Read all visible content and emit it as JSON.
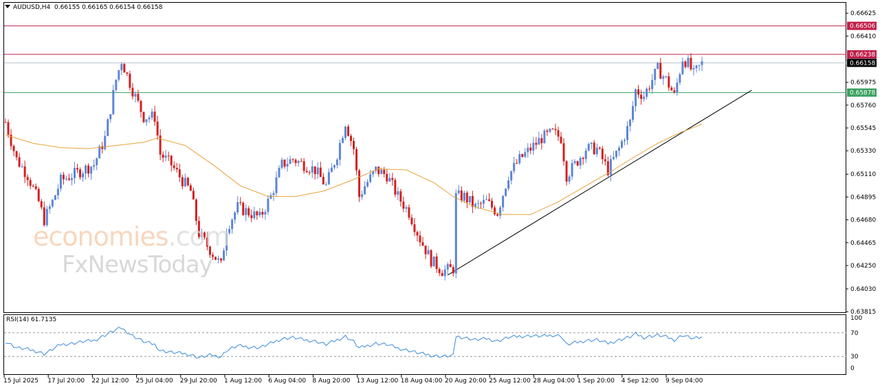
{
  "header": {
    "symbol": "AUDUSD,H4",
    "ohlc": "0.66155 0.66165 0.66154 0.66158"
  },
  "rsi_header": "RSI(14) 61.7135",
  "watermark": {
    "brand_main": "economies",
    "brand_suffix": ".com",
    "brand_second": "FxNewsToday"
  },
  "colors": {
    "bull": "#5b86d6",
    "bear": "#d32020",
    "ma": "#e8a23c",
    "rsi": "#3b8bd8",
    "resistance1": "#c0204a",
    "resistance2": "#c0204a",
    "support": "#3aa060",
    "current": "#000000"
  },
  "chart_data": {
    "type": "candlestick",
    "symbol": "AUDUSD",
    "timeframe": "H4",
    "ylim": [
      0.6381,
      0.6673
    ],
    "y_ticks": [
      "0.66625",
      "0.66410",
      "0.65975",
      "0.65760",
      "0.65545",
      "0.65330",
      "0.65110",
      "0.64895",
      "0.64680",
      "0.64465",
      "0.64250",
      "0.64030",
      "0.63815"
    ],
    "x_ticks": [
      "15 Jul 2025",
      "17 Jul 20:00",
      "22 Jul 12:00",
      "25 Jul 04:00",
      "29 Jul 20:00",
      "1 Aug 12:00",
      "6 Aug 04:00",
      "8 Aug 20:00",
      "13 Aug 12:00",
      "18 Aug 04:00",
      "20 Aug 20:00",
      "25 Aug 12:00",
      "28 Aug 04:00",
      "1 Sep 20:00",
      "4 Sep 12:00",
      "9 Sep 04:00"
    ],
    "horizontal_lines": [
      {
        "label": "0.66506",
        "value": 0.66506,
        "role": "resistance"
      },
      {
        "label": "0.66238",
        "value": 0.66238,
        "role": "resistance"
      },
      {
        "label": "0.66158",
        "value": 0.66158,
        "role": "current price"
      },
      {
        "label": "0.65878",
        "value": 0.65878,
        "role": "support"
      }
    ],
    "trendline": {
      "from": {
        "bar": 160,
        "price": 0.6416
      },
      "to": {
        "bar": 270,
        "price": 0.659
      }
    },
    "close_path": [
      [
        0,
        0.656
      ],
      [
        4,
        0.6525
      ],
      [
        8,
        0.651
      ],
      [
        12,
        0.6485
      ],
      [
        14,
        0.6468
      ],
      [
        17,
        0.6485
      ],
      [
        20,
        0.6505
      ],
      [
        24,
        0.651
      ],
      [
        28,
        0.6515
      ],
      [
        32,
        0.652
      ],
      [
        36,
        0.6545
      ],
      [
        40,
        0.66
      ],
      [
        42,
        0.6618
      ],
      [
        46,
        0.659
      ],
      [
        50,
        0.6565
      ],
      [
        54,
        0.6565
      ],
      [
        56,
        0.653
      ],
      [
        60,
        0.652
      ],
      [
        64,
        0.6505
      ],
      [
        67,
        0.6495
      ],
      [
        70,
        0.6455
      ],
      [
        74,
        0.644
      ],
      [
        78,
        0.6425
      ],
      [
        80,
        0.646
      ],
      [
        84,
        0.648
      ],
      [
        88,
        0.6475
      ],
      [
        92,
        0.647
      ],
      [
        96,
        0.649
      ],
      [
        100,
        0.652
      ],
      [
        104,
        0.6525
      ],
      [
        108,
        0.652
      ],
      [
        112,
        0.6515
      ],
      [
        116,
        0.65
      ],
      [
        120,
        0.653
      ],
      [
        123,
        0.656
      ],
      [
        126,
        0.6535
      ],
      [
        128,
        0.649
      ],
      [
        130,
        0.65
      ],
      [
        134,
        0.6515
      ],
      [
        138,
        0.651
      ],
      [
        142,
        0.649
      ],
      [
        146,
        0.6475
      ],
      [
        150,
        0.645
      ],
      [
        154,
        0.643
      ],
      [
        158,
        0.642
      ],
      [
        162,
        0.6422
      ],
      [
        163,
        0.649
      ],
      [
        166,
        0.649
      ],
      [
        170,
        0.648
      ],
      [
        174,
        0.6485
      ],
      [
        178,
        0.6475
      ],
      [
        182,
        0.651
      ],
      [
        186,
        0.6525
      ],
      [
        190,
        0.6535
      ],
      [
        194,
        0.6545
      ],
      [
        198,
        0.655
      ],
      [
        201,
        0.6545
      ],
      [
        203,
        0.651
      ],
      [
        206,
        0.652
      ],
      [
        210,
        0.6535
      ],
      [
        214,
        0.6535
      ],
      [
        218,
        0.6515
      ],
      [
        222,
        0.6535
      ],
      [
        226,
        0.656
      ],
      [
        228,
        0.659
      ],
      [
        231,
        0.6585
      ],
      [
        233,
        0.6595
      ],
      [
        236,
        0.661
      ],
      [
        239,
        0.66
      ],
      [
        242,
        0.6585
      ],
      [
        245,
        0.662
      ],
      [
        247,
        0.6615
      ],
      [
        249,
        0.6605
      ],
      [
        252,
        0.6615
      ]
    ],
    "ma_path": [
      [
        0,
        0.6548
      ],
      [
        10,
        0.654
      ],
      [
        20,
        0.6536
      ],
      [
        30,
        0.6535
      ],
      [
        40,
        0.6538
      ],
      [
        50,
        0.6541
      ],
      [
        55,
        0.6545
      ],
      [
        65,
        0.6538
      ],
      [
        75,
        0.652
      ],
      [
        85,
        0.65
      ],
      [
        95,
        0.649
      ],
      [
        105,
        0.649
      ],
      [
        115,
        0.6495
      ],
      [
        125,
        0.6505
      ],
      [
        135,
        0.6516
      ],
      [
        145,
        0.6515
      ],
      [
        155,
        0.6503
      ],
      [
        162,
        0.649
      ],
      [
        170,
        0.648
      ],
      [
        180,
        0.6473
      ],
      [
        190,
        0.6473
      ],
      [
        200,
        0.6485
      ],
      [
        210,
        0.65
      ],
      [
        220,
        0.6515
      ],
      [
        228,
        0.6528
      ],
      [
        236,
        0.654
      ],
      [
        244,
        0.655
      ],
      [
        252,
        0.6558
      ]
    ],
    "rsi": {
      "period": 14,
      "value": 61.7135,
      "levels": [
        70,
        30
      ],
      "axis_labels": [
        "100",
        "70",
        "30",
        "0"
      ],
      "path": [
        [
          0,
          55
        ],
        [
          4,
          45
        ],
        [
          8,
          42
        ],
        [
          12,
          38
        ],
        [
          14,
          34
        ],
        [
          17,
          42
        ],
        [
          20,
          50
        ],
        [
          24,
          52
        ],
        [
          28,
          55
        ],
        [
          32,
          57
        ],
        [
          36,
          66
        ],
        [
          40,
          75
        ],
        [
          42,
          78
        ],
        [
          46,
          65
        ],
        [
          50,
          55
        ],
        [
          54,
          50
        ],
        [
          56,
          40
        ],
        [
          60,
          37
        ],
        [
          64,
          35
        ],
        [
          67,
          33
        ],
        [
          70,
          28
        ],
        [
          74,
          32
        ],
        [
          78,
          30
        ],
        [
          80,
          40
        ],
        [
          84,
          48
        ],
        [
          88,
          46
        ],
        [
          92,
          45
        ],
        [
          96,
          52
        ],
        [
          100,
          60
        ],
        [
          104,
          62
        ],
        [
          108,
          58
        ],
        [
          112,
          56
        ],
        [
          116,
          50
        ],
        [
          120,
          58
        ],
        [
          123,
          64
        ],
        [
          126,
          55
        ],
        [
          128,
          44
        ],
        [
          130,
          47
        ],
        [
          134,
          52
        ],
        [
          138,
          50
        ],
        [
          142,
          44
        ],
        [
          146,
          40
        ],
        [
          150,
          35
        ],
        [
          154,
          32
        ],
        [
          158,
          30
        ],
        [
          162,
          31
        ],
        [
          163,
          64
        ],
        [
          166,
          62
        ],
        [
          170,
          58
        ],
        [
          174,
          60
        ],
        [
          178,
          56
        ],
        [
          182,
          62
        ],
        [
          186,
          64
        ],
        [
          190,
          65
        ],
        [
          194,
          64
        ],
        [
          198,
          66
        ],
        [
          201,
          65
        ],
        [
          203,
          50
        ],
        [
          206,
          53
        ],
        [
          210,
          57
        ],
        [
          214,
          58
        ],
        [
          218,
          52
        ],
        [
          222,
          58
        ],
        [
          226,
          63
        ],
        [
          228,
          68
        ],
        [
          231,
          62
        ],
        [
          233,
          64
        ],
        [
          236,
          66
        ],
        [
          239,
          63
        ],
        [
          242,
          58
        ],
        [
          245,
          66
        ],
        [
          247,
          63
        ],
        [
          249,
          60
        ],
        [
          252,
          62
        ]
      ]
    }
  }
}
